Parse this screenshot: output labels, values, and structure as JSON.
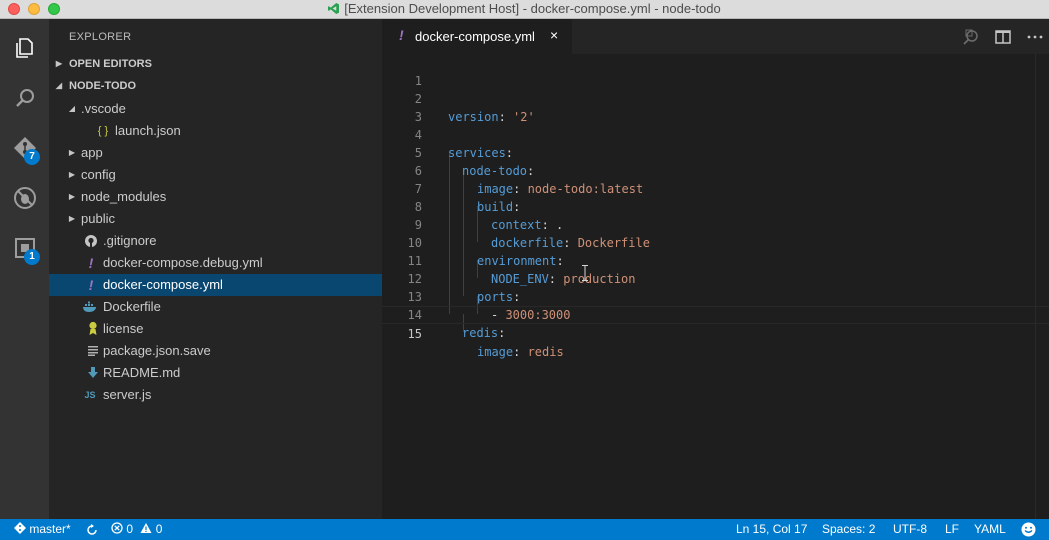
{
  "window": {
    "title": "[Extension Development Host] - docker-compose.yml - node-todo"
  },
  "activity_bar": {
    "items": [
      {
        "name": "explorer-icon"
      },
      {
        "name": "search-icon"
      },
      {
        "name": "git-icon",
        "badge": "7"
      },
      {
        "name": "debug-icon"
      },
      {
        "name": "extensions-icon",
        "badge": "1"
      }
    ]
  },
  "sidebar": {
    "title": "EXPLORER",
    "open_editors": "OPEN EDITORS",
    "project": "NODE-TODO",
    "tree": [
      {
        "label": ".vscode",
        "type": "folder-open"
      },
      {
        "label": "launch.json",
        "type": "json",
        "icon": "{ }"
      },
      {
        "label": "app",
        "type": "folder"
      },
      {
        "label": "config",
        "type": "folder"
      },
      {
        "label": "node_modules",
        "type": "folder"
      },
      {
        "label": "public",
        "type": "folder"
      },
      {
        "label": ".gitignore",
        "type": "git"
      },
      {
        "label": "docker-compose.debug.yml",
        "type": "yml",
        "icon": "!"
      },
      {
        "label": "docker-compose.yml",
        "type": "yml",
        "icon": "!"
      },
      {
        "label": "Dockerfile",
        "type": "docker"
      },
      {
        "label": "license",
        "type": "license"
      },
      {
        "label": "package.json.save",
        "type": "text"
      },
      {
        "label": "README.md",
        "type": "markdown"
      },
      {
        "label": "server.js",
        "type": "js",
        "icon": "JS"
      }
    ]
  },
  "editor": {
    "tab": {
      "label": "docker-compose.yml",
      "icon": "!",
      "close": "×"
    },
    "lines": [
      {
        "n": "1"
      },
      {
        "n": "2",
        "key": "version",
        "sep": ": ",
        "val": "'2'"
      },
      {
        "n": "3"
      },
      {
        "n": "4",
        "key": "services",
        "sep": ":"
      },
      {
        "n": "5",
        "key": "node-todo",
        "sep": ":"
      },
      {
        "n": "6",
        "key": "image",
        "sep": ": ",
        "val": "node-todo:latest"
      },
      {
        "n": "7",
        "key": "build",
        "sep": ":"
      },
      {
        "n": "8",
        "key": "context",
        "sep": ": ",
        "plain": "."
      },
      {
        "n": "9",
        "key": "dockerfile",
        "sep": ": ",
        "val": "Dockerfile"
      },
      {
        "n": "10",
        "key": "environment",
        "sep": ":"
      },
      {
        "n": "11",
        "key": "NODE_ENV",
        "sep": ": ",
        "val": "production"
      },
      {
        "n": "12",
        "key": "ports",
        "sep": ":"
      },
      {
        "n": "13",
        "dash": "- ",
        "val": "3000:3000"
      },
      {
        "n": "14",
        "key": "redis",
        "sep": ":"
      },
      {
        "n": "15",
        "key": "image",
        "sep": ": ",
        "val": "redis"
      }
    ]
  },
  "status_bar": {
    "branch": "master*",
    "errors": "0",
    "warnings": "0",
    "position": "Ln 15, Col 17",
    "spaces": "Spaces: 2",
    "encoding": "UTF-8",
    "eol": "LF",
    "language": "YAML"
  },
  "colors": {
    "accent": "#007acc",
    "selection": "#094771",
    "yaml_key": "#569cd6",
    "yaml_value": "#ce9178"
  }
}
